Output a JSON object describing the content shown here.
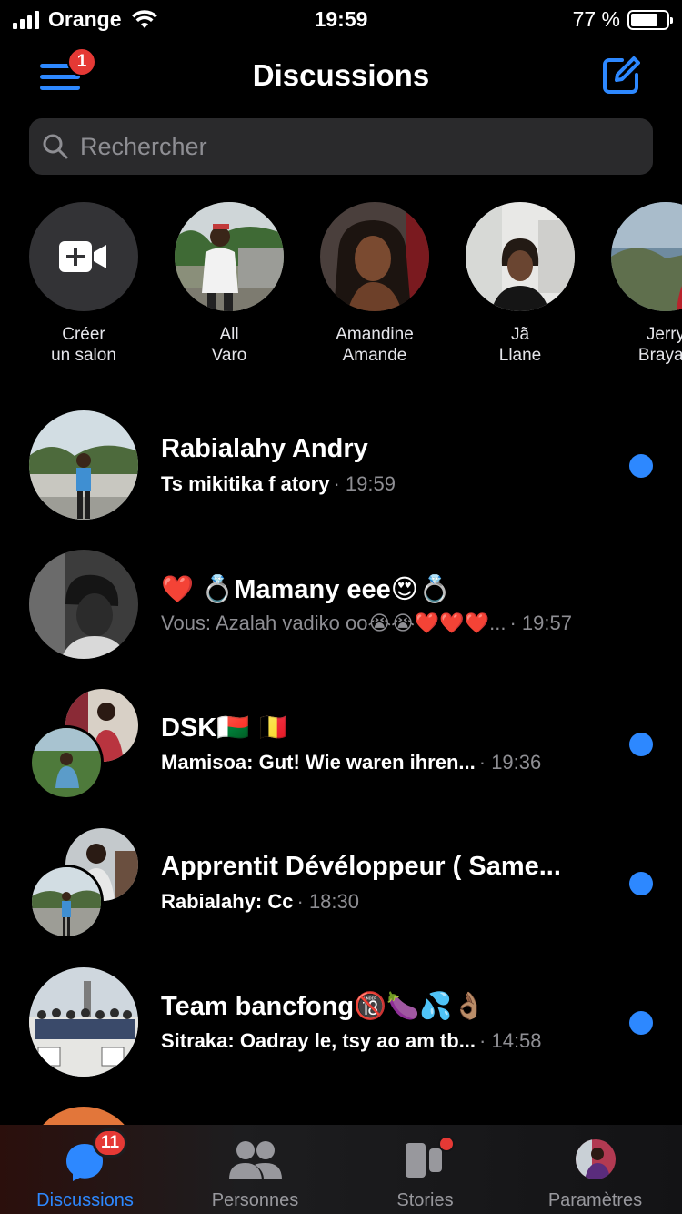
{
  "status_bar": {
    "carrier": "Orange",
    "time": "19:59",
    "battery_text": "77 %",
    "battery_level": 0.77
  },
  "header": {
    "title": "Discussions",
    "menu_badge": "1",
    "menu_icon": "hamburger-menu-icon",
    "compose_icon": "compose-icon"
  },
  "search": {
    "placeholder": "Rechercher"
  },
  "stories": [
    {
      "line1": "Créer",
      "line2": "un salon"
    },
    {
      "line1": "All",
      "line2": "Varo"
    },
    {
      "line1": "Amandine",
      "line2": "Amande"
    },
    {
      "line1": "Jã",
      "line2": "Llane"
    },
    {
      "line1": "Jerry",
      "line2": "Brayan"
    }
  ],
  "conversations": [
    {
      "name": "Rabialahy Andry",
      "message": "Ts mikitika f atory",
      "time": "· 19:59",
      "unread": true
    },
    {
      "name": "❤️ 💍Mamany eee😍💍",
      "message": "Vous: Azalah vadiko oo😭😭❤️❤️❤️...",
      "time": " · 19:57",
      "unread": false
    },
    {
      "name": "DSK🇲🇬 🇧🇪",
      "message": "Mamisoa: Gut! Wie waren ihren...",
      "time": " · 19:36",
      "unread": true
    },
    {
      "name": "Apprentit Dévéloppeur ( Same...",
      "message": "Rabialahy: Cc",
      "time": "· 18:30",
      "unread": true
    },
    {
      "name": "Team bancfong🔞🍆💦👌🏽",
      "message": "Sitraka: Oadray le, tsy ao am tb...",
      "time": " · 14:58",
      "unread": true
    }
  ],
  "tabbar": {
    "tabs": [
      {
        "label": "Discussions",
        "badge": "11",
        "icon": "chat-bubble-icon"
      },
      {
        "label": "Personnes",
        "icon": "people-icon"
      },
      {
        "label": "Stories",
        "icon": "stories-icon"
      },
      {
        "label": "Paramètres",
        "icon": "profile-avatar-icon"
      }
    ]
  },
  "colors": {
    "accent": "#2d88ff",
    "badge": "#e53935",
    "background": "#000000"
  }
}
